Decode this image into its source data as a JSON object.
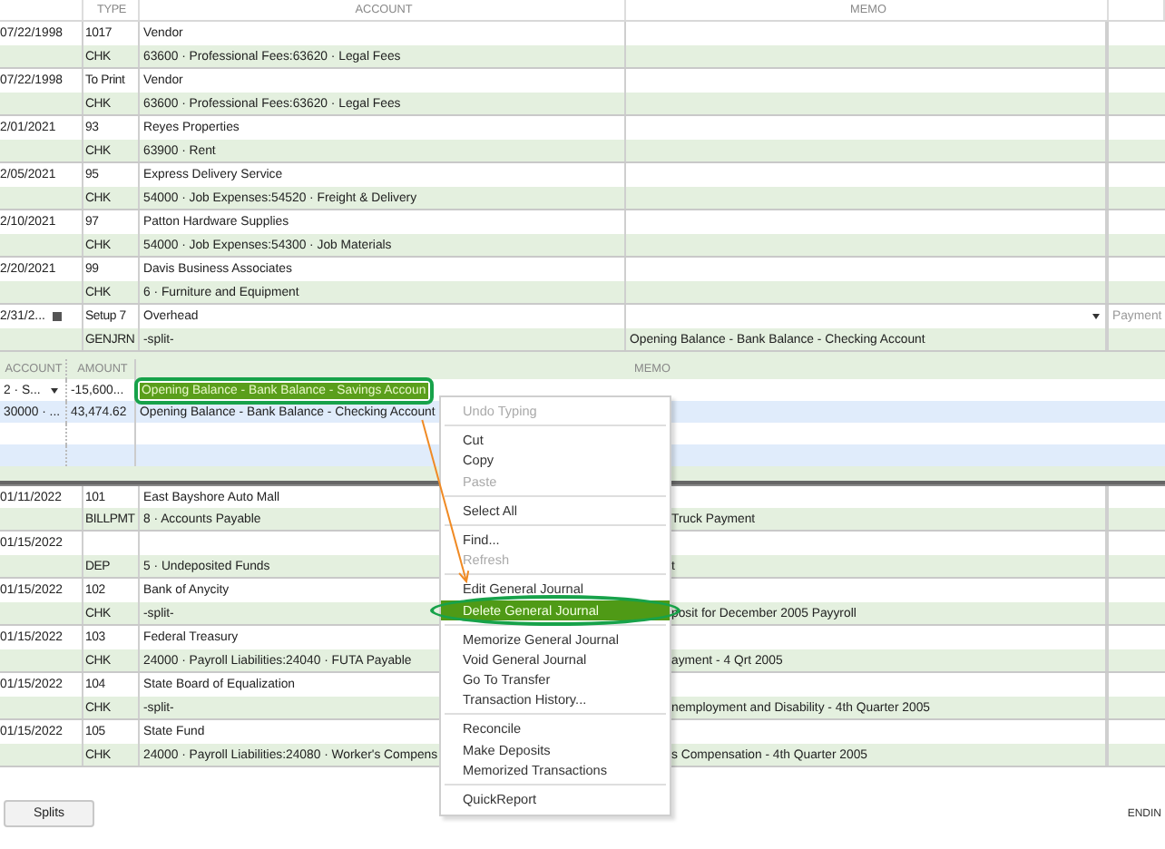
{
  "register": {
    "columns": [
      "TYPE",
      "ACCOUNT",
      "MEMO"
    ],
    "transactions": [
      {
        "date": "07/22/1998",
        "number": "1017",
        "payee": "Vendor",
        "type": "CHK",
        "account": "63600 · Professional Fees:63620 · Legal Fees",
        "editing": false
      },
      {
        "date": "07/22/1998",
        "number": "To Print",
        "payee": "Vendor",
        "type": "CHK",
        "account": "63600 · Professional Fees:63620 · Legal Fees",
        "editing": false
      },
      {
        "date": "2/01/2021",
        "number": "93",
        "payee": "Reyes Properties",
        "type": "CHK",
        "account": "63900 · Rent",
        "editing": false
      },
      {
        "date": "2/05/2021",
        "number": "95",
        "payee": "Express Delivery Service",
        "type": "CHK",
        "account": "54000 · Job Expenses:54520 · Freight & Delivery",
        "editing": false
      },
      {
        "date": "2/10/2021",
        "number": "97",
        "payee": "Patton Hardware Supplies",
        "type": "CHK",
        "account": "54000 · Job Expenses:54300 · Job Materials",
        "editing": false
      },
      {
        "date": "2/20/2021",
        "number": "99",
        "payee": "Davis Business Associates",
        "type": "CHK",
        "account": "6 · Furniture and Equipment",
        "editing": false
      },
      {
        "date": "2/31/2...",
        "number": "Setup 7",
        "payee": "Overhead",
        "type": "GENJRN",
        "account": "-split-",
        "memo": "Opening Balance - Bank Balance - Checking Account",
        "payment_placeholder": "Payment",
        "editing": true
      }
    ]
  },
  "splits": {
    "columns": [
      "ACCOUNT",
      "AMOUNT",
      "MEMO"
    ],
    "rows": [
      {
        "account": "2 · S...",
        "amount": "-15,600...",
        "memo": "Opening Balance - Bank Balance - Savings Accoun",
        "selected": true,
        "circled": true
      },
      {
        "account": "30000 · ...",
        "amount": "43,474.62",
        "memo": "Opening Balance - Bank Balance - Checking Account",
        "selected": false,
        "circled": false
      }
    ]
  },
  "lower_register": {
    "transactions": [
      {
        "date": "01/11/2022",
        "number": "101",
        "payee": "East Bayshore Auto Mall",
        "type": "BILLPMT",
        "account": "8 · Accounts Payable",
        "memo": "Truck Payment"
      },
      {
        "date": "01/15/2022",
        "type": "DEP",
        "account": "5 · Undeposited Funds",
        "memo": "t"
      },
      {
        "date": "01/15/2022",
        "number": "102",
        "payee": "Bank of Anycity",
        "type": "CHK",
        "account": "-split-",
        "memo": "posit for December 2005 Payyroll"
      },
      {
        "date": "01/15/2022",
        "number": "103",
        "payee": "Federal Treasury",
        "type": "CHK",
        "account": "24000 · Payroll Liabilities:24040 · FUTA Payable",
        "memo": "ayment - 4 Qrt 2005"
      },
      {
        "date": "01/15/2022",
        "number": "104",
        "payee": "State Board of Equalization",
        "type": "CHK",
        "account": "-split-",
        "memo": "nemployment and Disability - 4th Quarter 2005"
      },
      {
        "date": "01/15/2022",
        "number": "105",
        "payee": "State Fund",
        "type": "CHK",
        "account": "24000 · Payroll Liabilities:24080 · Worker's Compens",
        "memo": "s Compensation - 4th Quarter 2005"
      }
    ]
  },
  "context_menu": {
    "items": [
      {
        "kind": "item",
        "label": "Undo Typing",
        "disabled": true,
        "selected": false,
        "circled": false
      },
      {
        "kind": "separator"
      },
      {
        "kind": "item",
        "label": "Cut",
        "disabled": false,
        "selected": false,
        "circled": false
      },
      {
        "kind": "item",
        "label": "Copy",
        "disabled": false,
        "selected": false,
        "circled": false
      },
      {
        "kind": "item",
        "label": "Paste",
        "disabled": true,
        "selected": false,
        "circled": false
      },
      {
        "kind": "separator"
      },
      {
        "kind": "item",
        "label": "Select All",
        "disabled": false,
        "selected": false,
        "circled": false
      },
      {
        "kind": "separator"
      },
      {
        "kind": "item",
        "label": "Find...",
        "disabled": false,
        "selected": false,
        "circled": false
      },
      {
        "kind": "item",
        "label": "Refresh",
        "disabled": true,
        "selected": false,
        "circled": false
      },
      {
        "kind": "separator"
      },
      {
        "kind": "item",
        "label": "Edit General Journal",
        "disabled": false,
        "selected": false,
        "circled": false
      },
      {
        "kind": "item",
        "label": "Delete General Journal",
        "disabled": false,
        "selected": true,
        "circled": true
      },
      {
        "kind": "separator"
      },
      {
        "kind": "item",
        "label": "Memorize General Journal",
        "disabled": false,
        "selected": false,
        "circled": false
      },
      {
        "kind": "item",
        "label": "Void General Journal",
        "disabled": false,
        "selected": false,
        "circled": false
      },
      {
        "kind": "item",
        "label": "Go To Transfer",
        "disabled": false,
        "selected": false,
        "circled": false
      },
      {
        "kind": "item",
        "label": "Transaction History...",
        "disabled": false,
        "selected": false,
        "circled": false
      },
      {
        "kind": "separator"
      },
      {
        "kind": "item",
        "label": "Reconcile",
        "disabled": false,
        "selected": false,
        "circled": false
      },
      {
        "kind": "item",
        "label": "Make Deposits",
        "disabled": false,
        "selected": false,
        "circled": false
      },
      {
        "kind": "item",
        "label": "Memorized Transactions",
        "disabled": false,
        "selected": false,
        "circled": false
      },
      {
        "kind": "separator"
      },
      {
        "kind": "item",
        "label": "QuickReport",
        "disabled": false,
        "selected": false,
        "circled": false
      }
    ]
  },
  "annotation_arrow": true,
  "footer": {
    "buttons": [
      "Splits"
    ],
    "ending_label": "ENDIN"
  }
}
